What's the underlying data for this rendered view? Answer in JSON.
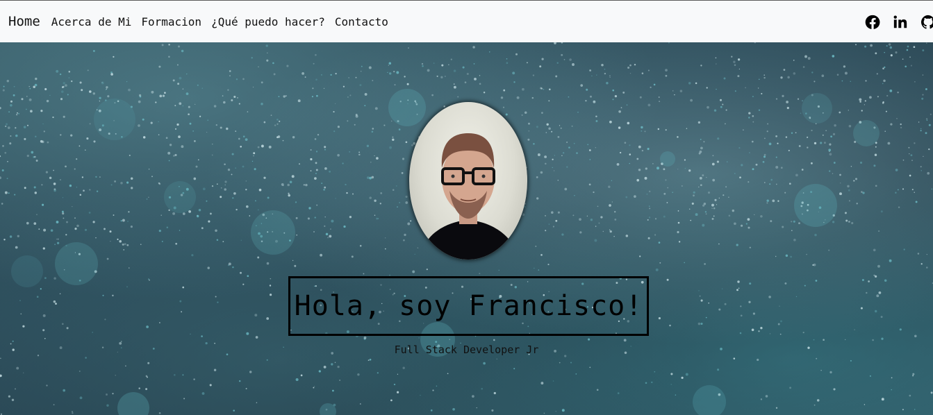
{
  "navbar": {
    "brand": "Home",
    "links": [
      "Acerca de Mi",
      "Formacion",
      "¿Qué puedo hacer?",
      "Contacto"
    ],
    "social_icons": [
      "facebook-icon",
      "linkedin-icon",
      "github-icon"
    ]
  },
  "hero": {
    "title": "Hola, soy Francisco!",
    "subtitle": "Full Stack Developer Jr"
  },
  "colors": {
    "navbar_bg": "#f8f9fa",
    "text": "#111111",
    "hero_bg": "#2b4957"
  }
}
